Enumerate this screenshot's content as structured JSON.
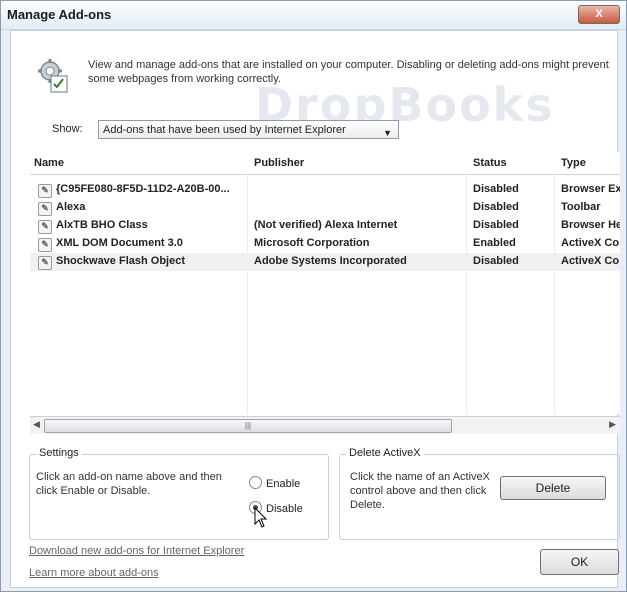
{
  "window": {
    "title": "Manage Add-ons",
    "close_label": "X"
  },
  "intro": "View and manage add-ons that are installed on your computer. Disabling or deleting add-ons might prevent some webpages from working correctly.",
  "watermark": "DropBooks",
  "show": {
    "label": "Show:",
    "selected": "Add-ons that have been used by Internet Explorer"
  },
  "table": {
    "columns": [
      "Name",
      "Publisher",
      "Status",
      "Type"
    ],
    "rows": [
      {
        "name": "{C95FE080-8F5D-11D2-A20B-00...",
        "publisher": "",
        "status": "Disabled",
        "type": "Browser Ex"
      },
      {
        "name": "Alexa",
        "publisher": "",
        "status": "Disabled",
        "type": "Toolbar"
      },
      {
        "name": "AlxTB BHO Class",
        "publisher": "(Not verified) Alexa Internet",
        "status": "Disabled",
        "type": "Browser He"
      },
      {
        "name": "XML DOM Document 3.0",
        "publisher": "Microsoft Corporation",
        "status": "Enabled",
        "type": "ActiveX Co"
      },
      {
        "name": "Shockwave Flash Object",
        "publisher": "Adobe Systems Incorporated",
        "status": "Disabled",
        "type": "ActiveX Co"
      }
    ]
  },
  "settings": {
    "title": "Settings",
    "text": "Click an add-on name above and then click Enable or Disable.",
    "enable_label": "Enable",
    "disable_label": "Disable",
    "selected": "Disable"
  },
  "delete_activex": {
    "title": "Delete ActiveX",
    "text": "Click the name of an ActiveX control above and then click Delete.",
    "button": "Delete"
  },
  "links": {
    "download": "Download new add-ons for Internet Explorer",
    "learn": "Learn more about add-ons"
  },
  "ok_button": "OK"
}
